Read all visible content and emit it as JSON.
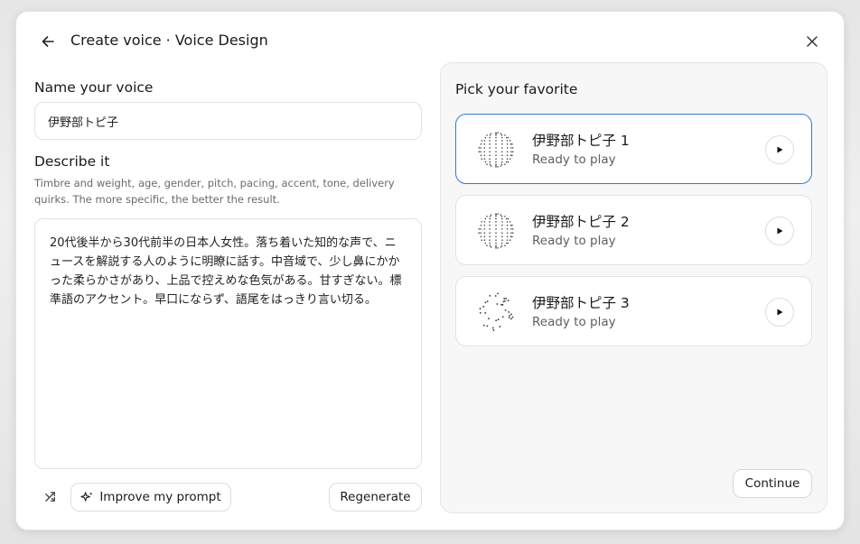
{
  "header": {
    "title": "Create voice · Voice Design"
  },
  "name_section": {
    "label": "Name your voice",
    "value": "伊野部トピ子"
  },
  "describe_section": {
    "label": "Describe it",
    "help": "Timbre and weight, age, gender, pitch, pacing, accent, tone, delivery quirks. The more specific, the better the result.",
    "value": "20代後半から30代前半の日本人女性。落ち着いた知的な声で、ニュースを解説する人のように明瞭に話す。中音域で、少し鼻にかかった柔らかさがあり、上品で控えめな色気がある。甘すぎない。標準語のアクセント。早口にならず、語尾をはっきり言い切る。"
  },
  "actions": {
    "improve_label": "Improve my prompt",
    "regenerate_label": "Regenerate"
  },
  "favorites": {
    "title": "Pick your favorite",
    "voices": [
      {
        "name": "伊野部トピ子 1",
        "status": "Ready to play"
      },
      {
        "name": "伊野部トピ子 2",
        "status": "Ready to play"
      },
      {
        "name": "伊野部トピ子 3",
        "status": "Ready to play"
      }
    ],
    "continue_label": "Continue"
  },
  "colors": {
    "selected_border": "#2c7be0"
  },
  "icons": [
    "arrow-left-icon",
    "close-icon",
    "shuffle-icon",
    "sparkle-icon",
    "play-icon",
    "voice-orb-icon"
  ]
}
